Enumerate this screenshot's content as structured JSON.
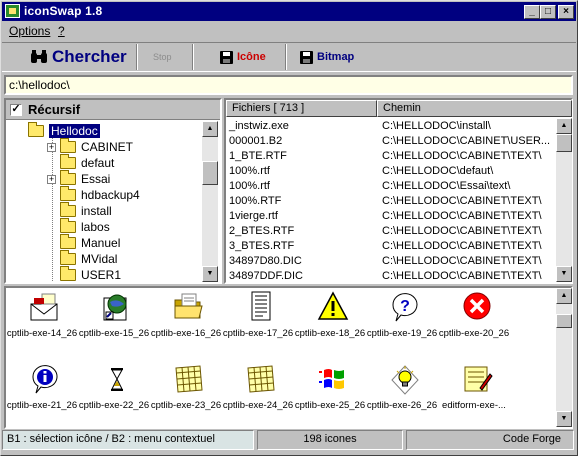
{
  "window": {
    "title": "iconSwap 1.8",
    "min": "_",
    "max": "□",
    "close": "×"
  },
  "menu": {
    "options": "Options",
    "help": "?"
  },
  "toolbar": {
    "search_label": "Chercher",
    "stop_label": "Stop",
    "icon_label": "Icône",
    "bitmap_label": "Bitmap",
    "colors": {
      "search": "#000080",
      "icon": "#cc0000",
      "bitmap": "#000080",
      "stop": "#8c8c8c"
    }
  },
  "path": {
    "value": "c:\\hellodoc\\"
  },
  "tree": {
    "recursive_label": "Récursif",
    "recursive_checked": "✓",
    "items": [
      {
        "label": "Hellodoc",
        "expander": "⊟"
      },
      {
        "label": "CABINET",
        "expander": "+"
      },
      {
        "label": "defaut",
        "expander": ""
      },
      {
        "label": "Essai",
        "expander": "+"
      },
      {
        "label": "hdbackup4",
        "expander": ""
      },
      {
        "label": "install",
        "expander": ""
      },
      {
        "label": "labos",
        "expander": ""
      },
      {
        "label": "Manuel",
        "expander": ""
      },
      {
        "label": "MVidal",
        "expander": ""
      },
      {
        "label": "USER1",
        "expander": ""
      }
    ]
  },
  "files": {
    "col_files": "Fichiers [ 713 ]",
    "col_path": "Chemin",
    "rows": [
      {
        "name": "_instwiz.exe",
        "path": "C:\\HELLODOC\\install\\"
      },
      {
        "name": "000001.B2",
        "path": "C:\\HELLODOC\\CABINET\\USER..."
      },
      {
        "name": "1_BTE.RTF",
        "path": "C:\\HELLODOC\\CABINET\\TEXT\\"
      },
      {
        "name": "100%.rtf",
        "path": "C:\\HELLODOC\\defaut\\"
      },
      {
        "name": "100%.rtf",
        "path": "C:\\HELLODOC\\Essai\\text\\"
      },
      {
        "name": "100%.RTF",
        "path": "C:\\HELLODOC\\CABINET\\TEXT\\"
      },
      {
        "name": "1vierge.rtf",
        "path": "C:\\HELLODOC\\CABINET\\TEXT\\"
      },
      {
        "name": "2_BTES.RTF",
        "path": "C:\\HELLODOC\\CABINET\\TEXT\\"
      },
      {
        "name": "3_BTES.RTF",
        "path": "C:\\HELLODOC\\CABINET\\TEXT\\"
      },
      {
        "name": "34897D80.DIC",
        "path": "C:\\HELLODOC\\CABINET\\TEXT\\"
      },
      {
        "name": "34897DDF.DIC",
        "path": "C:\\HELLODOC\\CABINET\\TEXT\\"
      }
    ]
  },
  "icons": {
    "items": [
      {
        "label": "cptlib-exe-14_26",
        "icon": "envelope-icon"
      },
      {
        "label": "cptlib-exe-15_26",
        "icon": "network-globe-icon"
      },
      {
        "label": "cptlib-exe-16_26",
        "icon": "open-folder-icon"
      },
      {
        "label": "cptlib-exe-17_26",
        "icon": "document-icon"
      },
      {
        "label": "cptlib-exe-18_26",
        "icon": "warning-icon"
      },
      {
        "label": "cptlib-exe-19_26",
        "icon": "question-icon"
      },
      {
        "label": "cptlib-exe-20_26",
        "icon": "error-icon"
      },
      {
        "label": "cptlib-exe-21_26",
        "icon": "info-icon"
      },
      {
        "label": "cptlib-exe-22_26",
        "icon": "hourglass-icon"
      },
      {
        "label": "cptlib-exe-23_26",
        "icon": "spreadsheet-icon"
      },
      {
        "label": "cptlib-exe-24_26",
        "icon": "spreadsheet-icon"
      },
      {
        "label": "cptlib-exe-25_26",
        "icon": "windows-logo-icon"
      },
      {
        "label": "cptlib-exe-26_26",
        "icon": "lightbulb-icon"
      },
      {
        "label": "editform-exe-...",
        "icon": "edit-form-icon"
      }
    ]
  },
  "status": {
    "hint": "B1 : sélection icône  / B2 : menu contextuel",
    "count": "198 icones",
    "author": "Code Forge"
  }
}
